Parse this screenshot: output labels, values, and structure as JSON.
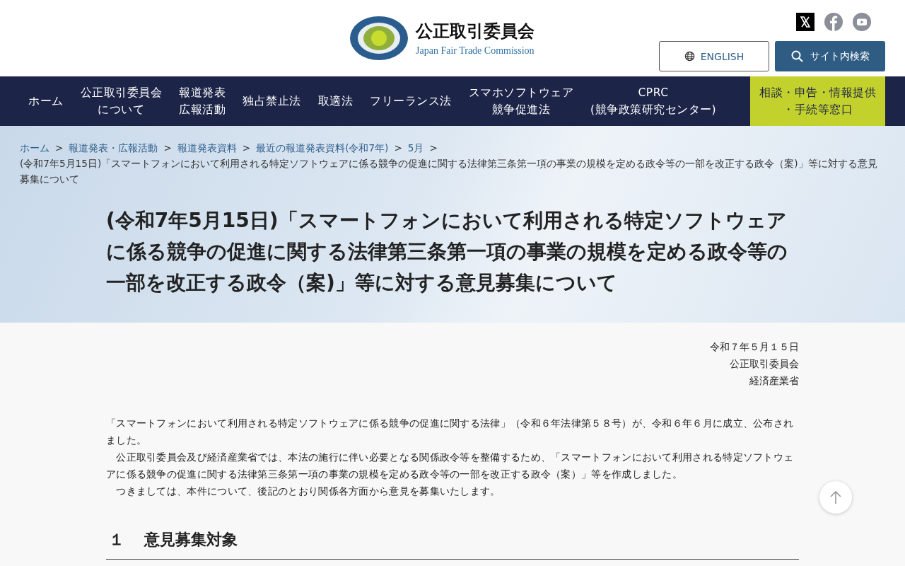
{
  "header": {
    "org_name": "公正取引委員会",
    "org_name_en": "Japan Fair Trade Commission",
    "english_button": "ENGLISH",
    "search_button": "サイト内検索"
  },
  "nav": [
    {
      "lines": [
        "ホーム"
      ],
      "kind": "normal"
    },
    {
      "lines": [
        "公正取引委員会",
        "について"
      ],
      "kind": "normal"
    },
    {
      "lines": [
        "報道発表",
        "広報活動"
      ],
      "kind": "normal"
    },
    {
      "lines": [
        "独占禁止法"
      ],
      "kind": "normal"
    },
    {
      "lines": [
        "取適法"
      ],
      "kind": "normal"
    },
    {
      "lines": [
        "フリーランス法"
      ],
      "kind": "normal"
    },
    {
      "lines": [
        "スマホソフトウェア",
        "競争促進法"
      ],
      "kind": "normal"
    },
    {
      "lines": [
        "CPRC",
        "(競争政策研究センター)"
      ],
      "kind": "normal"
    },
    {
      "lines": [
        "相談・申告・情報提供",
        "・手続等窓口"
      ],
      "kind": "accent"
    }
  ],
  "breadcrumb": [
    {
      "label": "ホーム",
      "separator": ">"
    },
    {
      "label": "報道発表・広報活動",
      "separator": ">"
    },
    {
      "label": "報道発表資料",
      "separator": ">"
    },
    {
      "label": "最近の報道発表資料(令和7年)",
      "separator": ">"
    },
    {
      "label": "5月",
      "separator": ">"
    }
  ],
  "breadcrumb_current": "(令和7年5月15日)「スマートフォンにおいて利用される特定ソフトウェアに係る競争の促進に関する法律第三条第一項の事業の規模を定める政令等の一部を改正する政令（案)」等に対する意見募集について",
  "page_title": "(令和7年5月15日)「スマートフォンにおいて利用される特定ソフトウェアに係る競争の促進に関する法律第三条第一項の事業の規模を定める政令等の一部を改正する政令（案)」等に対する意見募集について",
  "issue_lines": [
    "令和７年５月１５日",
    "公正取引委員会",
    "経済産業省"
  ],
  "paragraphs": [
    "「スマートフォンにおいて利用される特定ソフトウェアに係る競争の促進に関する法律」（令和６年法律第５８号）が、令和６年６月に成立、公布されました。",
    "　公正取引委員会及び経済産業省では、本法の施行に伴い必要となる関係政令等を整備するため、「スマートフォンにおいて利用される特定ソフトウェアに係る競争の促進に関する法律第三条第一項の事業の規模を定める政令等の一部を改正する政令（案）」等を作成しました。",
    "　つきましては、本件について、後記のとおり関係各方面から意見を募集いたします。"
  ],
  "section_heading": {
    "number": "１",
    "title": "意見募集対象"
  }
}
